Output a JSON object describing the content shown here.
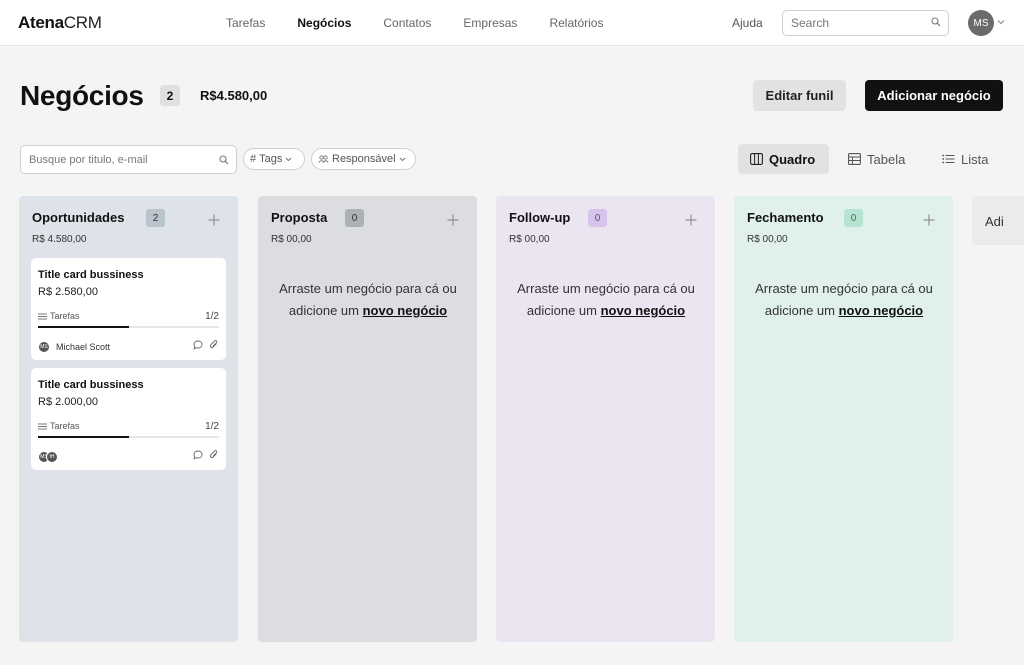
{
  "app": {
    "brand_bold": "Atena",
    "brand_light": "CRM"
  },
  "nav": [
    {
      "label": "Tarefas",
      "active": false
    },
    {
      "label": "Negócios",
      "active": true
    },
    {
      "label": "Contatos",
      "active": false
    },
    {
      "label": "Empresas",
      "active": false
    },
    {
      "label": "Relatórios",
      "active": false
    }
  ],
  "header_right": {
    "help": "Ajuda",
    "search_placeholder": "Search",
    "user_initials": "MS"
  },
  "page": {
    "title": "Negócios",
    "count": "2",
    "total": "R$4.580,00",
    "edit_label": "Editar funil",
    "add_label": "Adicionar negócio"
  },
  "filters": {
    "search_placeholder": "Busque por titulo, e-mail",
    "tags_label": "Tags",
    "responsavel_label": "Responsável"
  },
  "views": {
    "quadro": "Quadro",
    "tabela": "Tabela",
    "lista": "Lista"
  },
  "colors": {
    "col_oportunidades": "#dde3e8",
    "col_proposta": "#dcdde1",
    "col_followup": "#ebe5f2",
    "col_fechamento": "#e0f1ec"
  },
  "columns": [
    {
      "name": "Oportunidades",
      "count": "2",
      "total": "R$ 4.580,00",
      "cards": [
        {
          "title": "Title card bussiness",
          "value": "R$ 2.580,00",
          "tasks_label": "Tarefas",
          "tasks_fraction": "1/2",
          "progress": 0.5,
          "owner": "Michael Scott",
          "owner_initials": "MS"
        },
        {
          "title": "Title card bussiness",
          "value": "R$ 2.000,00",
          "tasks_label": "Tarefas",
          "tasks_fraction": "1/2",
          "progress": 0.5,
          "owner": "",
          "avatars": [
            "MS",
            "IH"
          ]
        }
      ]
    },
    {
      "name": "Proposta",
      "count": "0",
      "total": "R$ 00,00",
      "empty_text": "Arraste um negócio para cá ou adicione um",
      "empty_link": "novo negócio"
    },
    {
      "name": "Follow-up",
      "count": "0",
      "total": "R$ 00,00",
      "empty_text": "Arraste um negócio para cá ou adicione um",
      "empty_link": "novo negócio"
    },
    {
      "name": "Fechamento",
      "count": "0",
      "total": "R$ 00,00",
      "empty_text": "Arraste um negócio para cá ou adicione um",
      "empty_link": "novo negócio"
    },
    {
      "name_partial": "Adi"
    }
  ]
}
